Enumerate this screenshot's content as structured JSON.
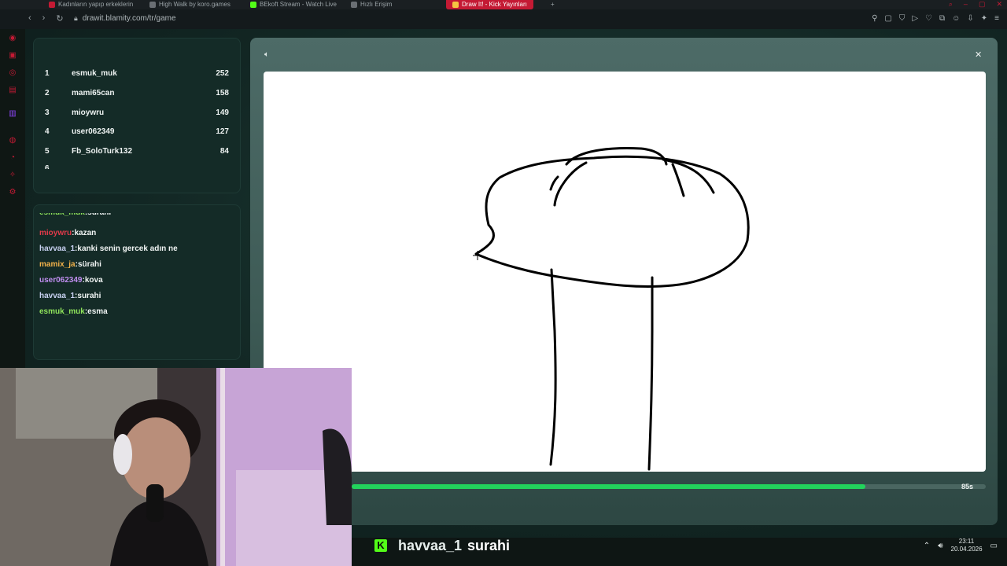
{
  "browser": {
    "tabs": [
      {
        "label": "Kadınların yapıp erkeklerin",
        "color": "#c41a34"
      },
      {
        "label": "High Walk by koro.games",
        "color": "#6a6f74"
      },
      {
        "label": "BEkoft Stream - Watch Live",
        "color": "#53fc18"
      },
      {
        "label": "Hızlı Erişim",
        "color": "#6a6f74"
      },
      {
        "label": "Draw It! - Kick Yayınları",
        "color": "#ffffff"
      }
    ],
    "url": "drawit.blamity.com/tr/game"
  },
  "leaderboard": [
    {
      "rank": "1",
      "name": "esmuk_muk",
      "score": "252"
    },
    {
      "rank": "2",
      "name": "mami65can",
      "score": "158"
    },
    {
      "rank": "3",
      "name": "mioywru",
      "score": "149"
    },
    {
      "rank": "4",
      "name": "user062349",
      "score": "127"
    },
    {
      "rank": "5",
      "name": "Fb_SoloTurk132",
      "score": "84"
    }
  ],
  "chat": [
    {
      "user": "esmuk_muk",
      "msg": "surahi",
      "color": "#8fe35b"
    },
    {
      "user": "mioywru",
      "msg": "kazan",
      "color": "#e23a4a"
    },
    {
      "user": "havvaa_1",
      "msg": "kanki senin gercek adın ne",
      "color": "#c9d2f2"
    },
    {
      "user": "mamix_ja",
      "msg": "sürahi",
      "color": "#f2b24a"
    },
    {
      "user": "user062349",
      "msg": "kova",
      "color": "#c08ef0"
    },
    {
      "user": "havvaa_1",
      "msg": "surahi",
      "color": "#c9d2f2"
    },
    {
      "user": "esmuk_muk",
      "msg": "esma",
      "color": "#8fe35b"
    }
  ],
  "game": {
    "timer_label": "85s",
    "timer_progress": 0.81
  },
  "overlay": {
    "user": "havvaa_1",
    "message": "surahi",
    "time": "23:11",
    "date": "20.04.2026"
  },
  "colors": {
    "accent": "#22d35c",
    "kick": "#53fc18",
    "opera": "#c41a34"
  }
}
